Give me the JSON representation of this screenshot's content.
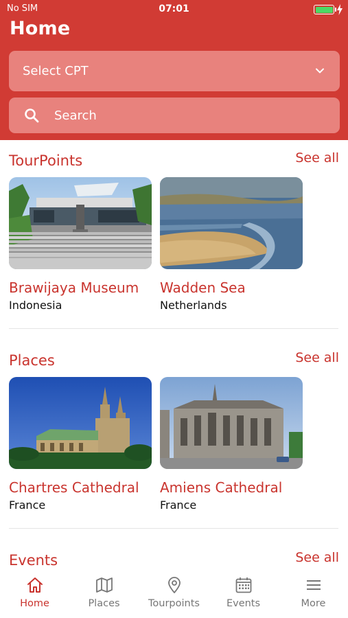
{
  "status_bar": {
    "carrier": "No SIM",
    "time": "07:01"
  },
  "header": {
    "title": "Home",
    "bg_color": "#d13b34"
  },
  "cpt_select": {
    "label": "Select CPT",
    "icon": "chevron-down-icon"
  },
  "search": {
    "placeholder": "Search",
    "icon": "search-icon"
  },
  "accent_color": "#c9342e",
  "sections": [
    {
      "title": "TourPoints",
      "see_all": "See all",
      "cards": [
        {
          "title": "Brawijaya Museum",
          "subtitle": "Indonesia",
          "image": "museum-photo"
        },
        {
          "title": "Wadden Sea",
          "subtitle": "Netherlands",
          "image": "coastline-photo"
        }
      ]
    },
    {
      "title": "Places",
      "see_all": "See all",
      "cards": [
        {
          "title": "Chartres Cathedral",
          "subtitle": "France",
          "image": "cathedral-photo"
        },
        {
          "title": "Amiens Cathedral",
          "subtitle": "France",
          "image": "cathedral-photo"
        }
      ]
    },
    {
      "title": "Events",
      "see_all": "See all"
    }
  ],
  "tabs": [
    {
      "label": "Home",
      "icon": "home-icon",
      "active": true
    },
    {
      "label": "Places",
      "icon": "map-icon",
      "active": false
    },
    {
      "label": "Tourpoints",
      "icon": "location-pin-icon",
      "active": false
    },
    {
      "label": "Events",
      "icon": "calendar-icon",
      "active": false
    },
    {
      "label": "More",
      "icon": "menu-icon",
      "active": false
    }
  ]
}
